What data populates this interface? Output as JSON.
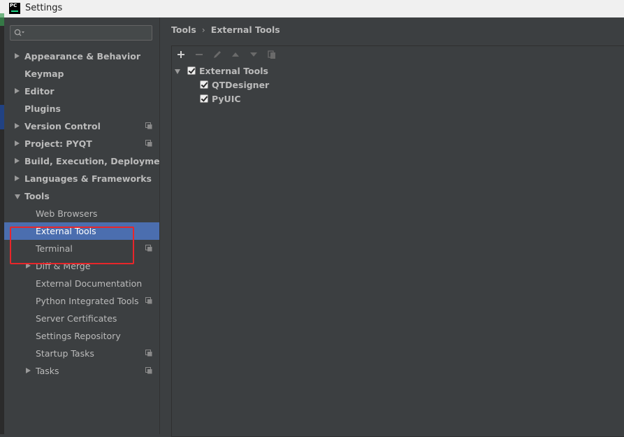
{
  "window": {
    "title": "Settings",
    "logo_text": "PC"
  },
  "search": {
    "placeholder": ""
  },
  "sidebar": {
    "items": [
      {
        "label": "Appearance & Behavior",
        "level": 0,
        "expander": "collapsed",
        "project_icon": false
      },
      {
        "label": "Keymap",
        "level": 0,
        "expander": "none",
        "project_icon": false
      },
      {
        "label": "Editor",
        "level": 0,
        "expander": "collapsed",
        "project_icon": false
      },
      {
        "label": "Plugins",
        "level": 0,
        "expander": "none",
        "project_icon": false
      },
      {
        "label": "Version Control",
        "level": 0,
        "expander": "collapsed",
        "project_icon": true
      },
      {
        "label": "Project: PYQT",
        "level": 0,
        "expander": "collapsed",
        "project_icon": true
      },
      {
        "label": "Build, Execution, Deployment",
        "level": 0,
        "expander": "collapsed",
        "project_icon": false
      },
      {
        "label": "Languages & Frameworks",
        "level": 0,
        "expander": "collapsed",
        "project_icon": false
      },
      {
        "label": "Tools",
        "level": 0,
        "expander": "expanded",
        "project_icon": false
      },
      {
        "label": "Web Browsers",
        "level": 1,
        "expander": "none",
        "project_icon": false
      },
      {
        "label": "External Tools",
        "level": 1,
        "expander": "none",
        "project_icon": false,
        "selected": true
      },
      {
        "label": "Terminal",
        "level": 1,
        "expander": "none",
        "project_icon": true
      },
      {
        "label": "Diff & Merge",
        "level": 1,
        "expander": "collapsed",
        "project_icon": false
      },
      {
        "label": "External Documentation",
        "level": 1,
        "expander": "none",
        "project_icon": false
      },
      {
        "label": "Python Integrated Tools",
        "level": 1,
        "expander": "none",
        "project_icon": true
      },
      {
        "label": "Server Certificates",
        "level": 1,
        "expander": "none",
        "project_icon": false
      },
      {
        "label": "Settings Repository",
        "level": 1,
        "expander": "none",
        "project_icon": false
      },
      {
        "label": "Startup Tasks",
        "level": 1,
        "expander": "none",
        "project_icon": true
      },
      {
        "label": "Tasks",
        "level": 1,
        "expander": "collapsed",
        "project_icon": true
      }
    ]
  },
  "breadcrumb": {
    "parent": "Tools",
    "separator": "›",
    "current": "External Tools"
  },
  "toolbar": {
    "buttons": [
      "plus-icon",
      "minus-icon",
      "edit-icon",
      "move-up-icon",
      "move-down-icon",
      "copy-icon"
    ]
  },
  "tools_tree": {
    "group": {
      "label": "External Tools",
      "checked": true,
      "expanded": true
    },
    "children": [
      {
        "label": "QTDesigner",
        "checked": true
      },
      {
        "label": "PyUIC",
        "checked": true
      }
    ]
  },
  "colors": {
    "selection": "#4b6eaf",
    "background": "#3c3f41",
    "annotation_box": "#e8262a"
  }
}
